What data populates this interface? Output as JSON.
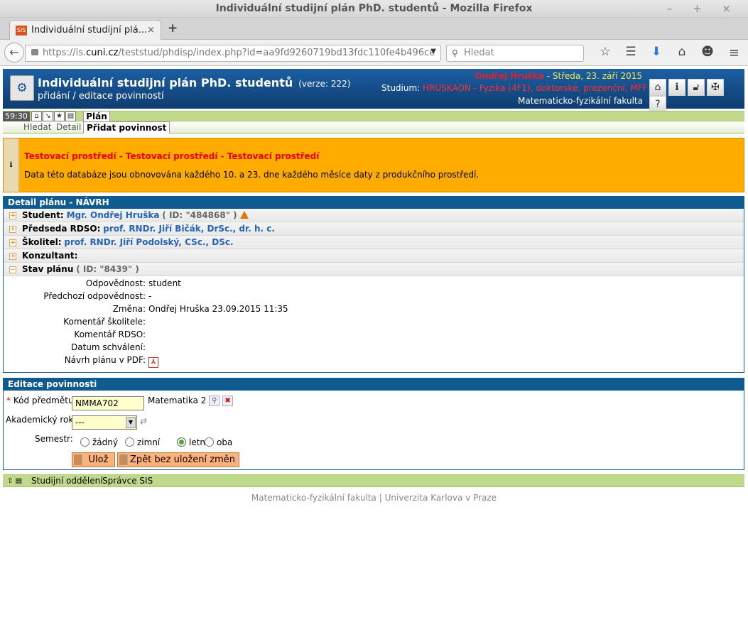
{
  "window": {
    "title": "Individuální studijní plán PhD. studentů - Mozilla Firefox",
    "controls": "– + ×"
  },
  "browser": {
    "tab_title": "Individuální studijní plá...",
    "tab_favicon": "SIS",
    "url_prefix": "https://is.",
    "url_host": "cuni.cz",
    "url_rest": "/teststud/phdisp/index.php?id=aa9fd9260719bd13fdc110fe4b496ce",
    "search_placeholder": "Hledat"
  },
  "app": {
    "title": "Individuální studijní plán PhD. studentů",
    "version": "(verze: 222)",
    "subtitle": "přidání / editace povinností",
    "user": "Ondřej Hruška",
    "date": "Středa, 23. září 2015",
    "study_label": "Studium:",
    "study_value": "HRUSKAON - Fyzika (4F1), doktorské, prezenční, MFF",
    "faculty": "Matematicko-fyzikální fakulta"
  },
  "menu": {
    "timer": "59:30",
    "plan_tab": "Plán",
    "sub_search": "Hledat",
    "sub_detail": "Detail",
    "sub_add": "Přidat povinnost"
  },
  "notice": {
    "title": "Testovací prostředí - Testovací prostředí - Testovací prostředí",
    "message": "Data této databáze jsou obnovována každého 10. a 23. dne každého měsíce daty z produkčního prostředí."
  },
  "detail": {
    "header": "Detail plánu - NÁVRH",
    "student_label": "Student:",
    "student_name": "Mgr. Ondřej Hruška",
    "student_id": "( ID: \"484868\" )",
    "chair_label": "Předseda RDSO:",
    "chair_name": "prof. RNDr. Jiří Bičák, DrSc., dr. h. c.",
    "supervisor_label": "Školitel:",
    "supervisor_name": "prof. RNDr. Jiří Podolský, CSc., DSc.",
    "consultant_label": "Konzultant:",
    "state_label": "Stav plánu",
    "state_id": "( ID: \"8439\" )",
    "fields": [
      {
        "label": "Odpovědnost:",
        "value": "student"
      },
      {
        "label": "Předchozí odpovědnost:",
        "value": "-"
      },
      {
        "label": "Změna:",
        "value": "Ondřej Hruška 23.09.2015 11:35"
      },
      {
        "label": "Komentář školitele:",
        "value": ""
      },
      {
        "label": "Komentář RDSO:",
        "value": ""
      },
      {
        "label": "Datum schválení:",
        "value": ""
      },
      {
        "label": "Návrh plánu v PDF:",
        "value": ""
      }
    ]
  },
  "edit": {
    "header": "Editace povinnosti",
    "code_label": "Kód předmětu:",
    "code_value": "NMMA702",
    "subject_name": "Matematika 2",
    "year_label": "Akademický rok:",
    "year_value": "---",
    "semester_label": "Semestr:",
    "semesters": [
      "žádný",
      "zimní",
      "letní",
      "oba"
    ],
    "semester_selected": "letní",
    "save": "Ulož",
    "back": "Zpět bez uložení změn"
  },
  "footer": {
    "dept": "Studijní oddělení",
    "admin": "Správce SIS",
    "faculty": "Matematicko-fyzikální fakulta",
    "sep": "|",
    "university": "Univerzita Karlova v Praze"
  }
}
